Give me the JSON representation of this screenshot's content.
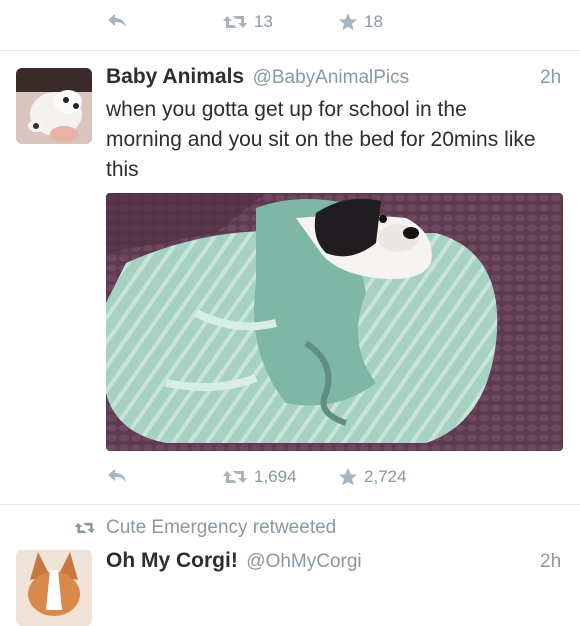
{
  "top_tweet_actions": {
    "retweets": "13",
    "favorites": "18"
  },
  "tweet": {
    "name": "Baby Animals",
    "handle": "@BabyAnimalPics",
    "time": "2h",
    "text": "when you gotta get up for school in the morning and you sit on the bed for 20mins like this",
    "retweets": "1,694",
    "favorites": "2,724"
  },
  "next_tweet": {
    "retweeted_by": "Cute Emergency retweeted",
    "name": "Oh My Corgi!",
    "handle": "@OhMyCorgi",
    "time": "2h"
  },
  "colors": {
    "text": "#292f33",
    "secondary": "#8899a6",
    "divider": "#e1e8ed",
    "blanket": "#9fcbbd",
    "bedspread": "#5e3a4f"
  },
  "icons": {
    "reply": "reply-arrow-icon",
    "retweet": "retweet-icon",
    "favorite": "star-icon"
  }
}
